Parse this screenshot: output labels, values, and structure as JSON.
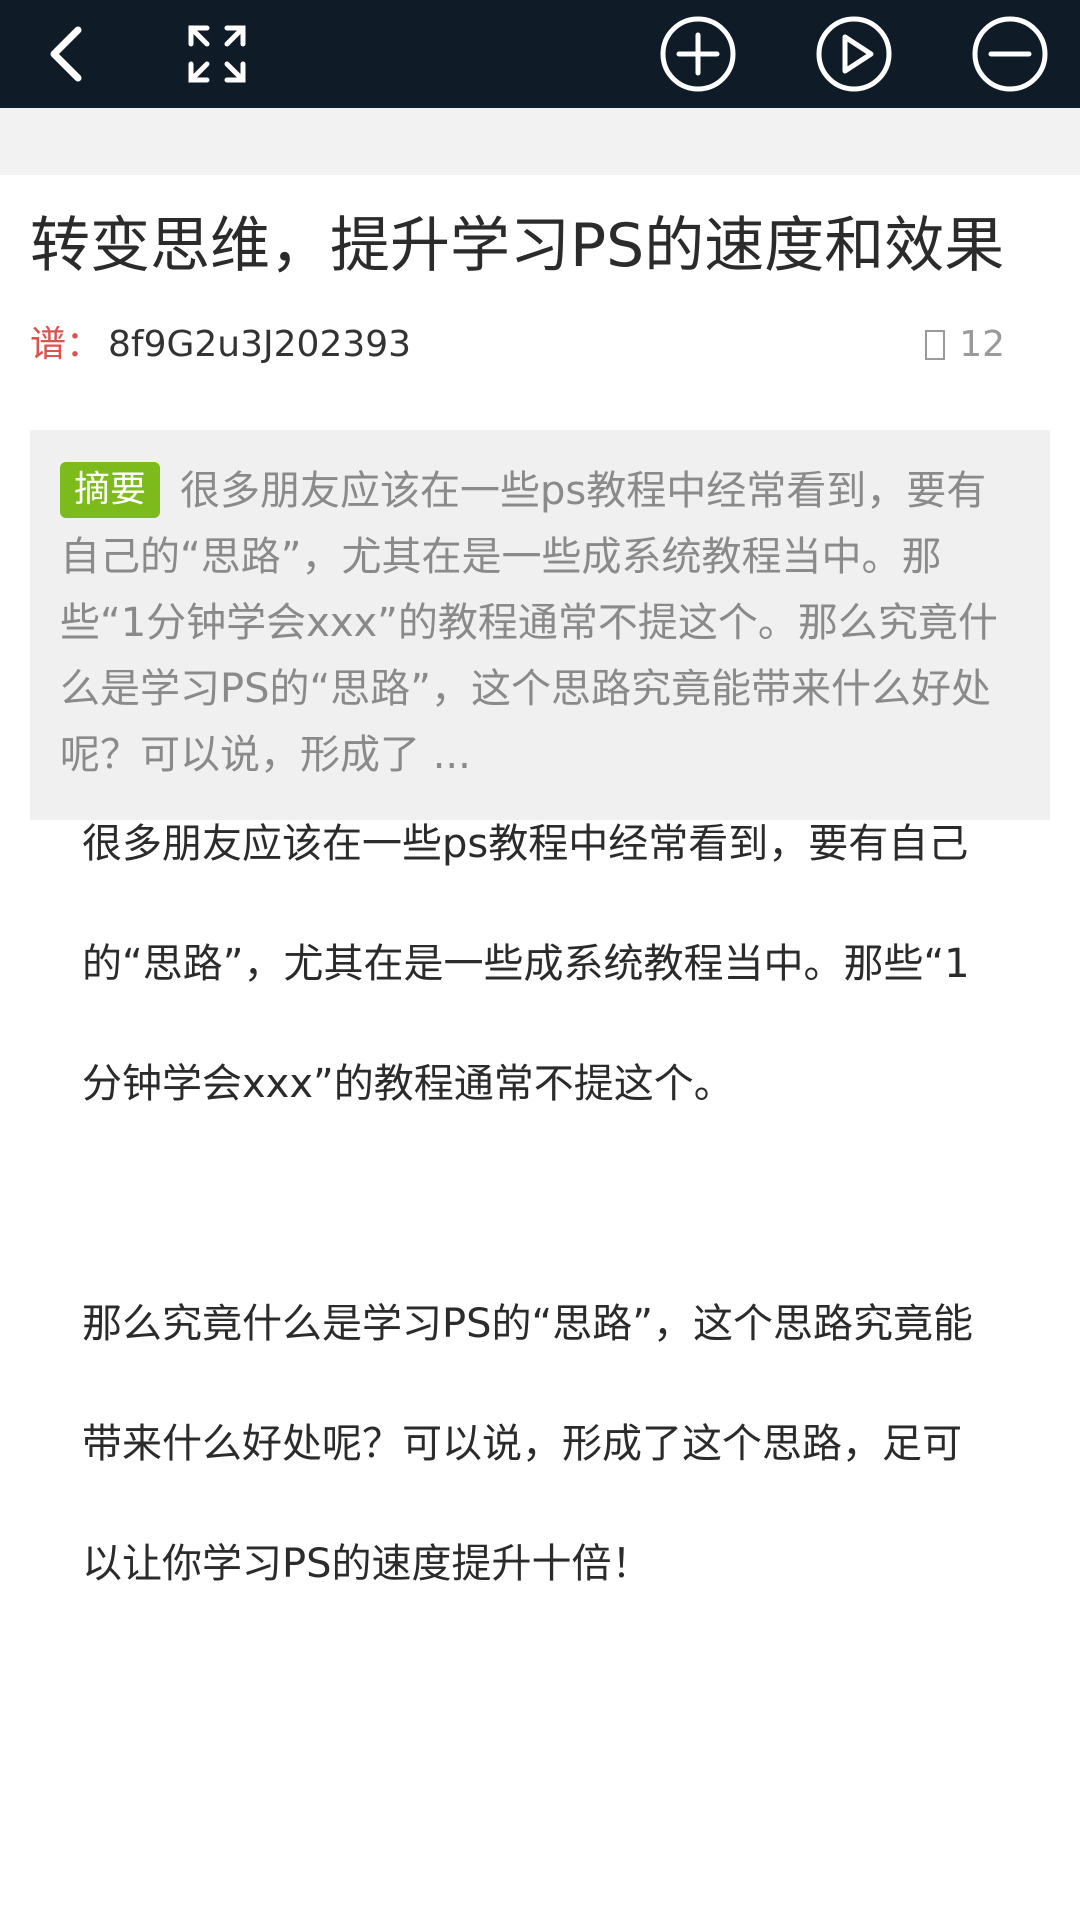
{
  "toolbar": {
    "icons": [
      "back-icon",
      "fullscreen-icon",
      "zoom-in-icon",
      "play-icon",
      "zoom-out-icon"
    ],
    "background_color": "#0f1b27"
  },
  "article": {
    "title": "转变思维，提升学习PS的速度和效果",
    "meta_label": "谱：",
    "meta_code": "8f9G2u3J202393",
    "count": "12",
    "summary_badge": "摘要",
    "summary_text": "很多朋友应该在一些ps教程中经常看到，要有自己的“思路”，尤其在是一些成系统教程当中。那些“1分钟学会xxx”的教程通常不提这个。那么究竟什么是学习PS的“思路”，这个思路究竟能带来什么好处呢？可以说，形成了 ...",
    "paragraphs": [
      "很多朋友应该在一些ps教程中经常看到，要有自己的“思路”，尤其在是一些成系统教程当中。那些“1分钟学会xxx”的教程通常不提这个。",
      "那么究竟什么是学习PS的“思路”，这个思路究竟能带来什么好处呢？可以说，形成了这个思路，足可以让你学习PS的速度提升十倍！"
    ]
  },
  "colors": {
    "badge_green": "#7dbb1d",
    "meta_label_red": "#d9534f"
  }
}
